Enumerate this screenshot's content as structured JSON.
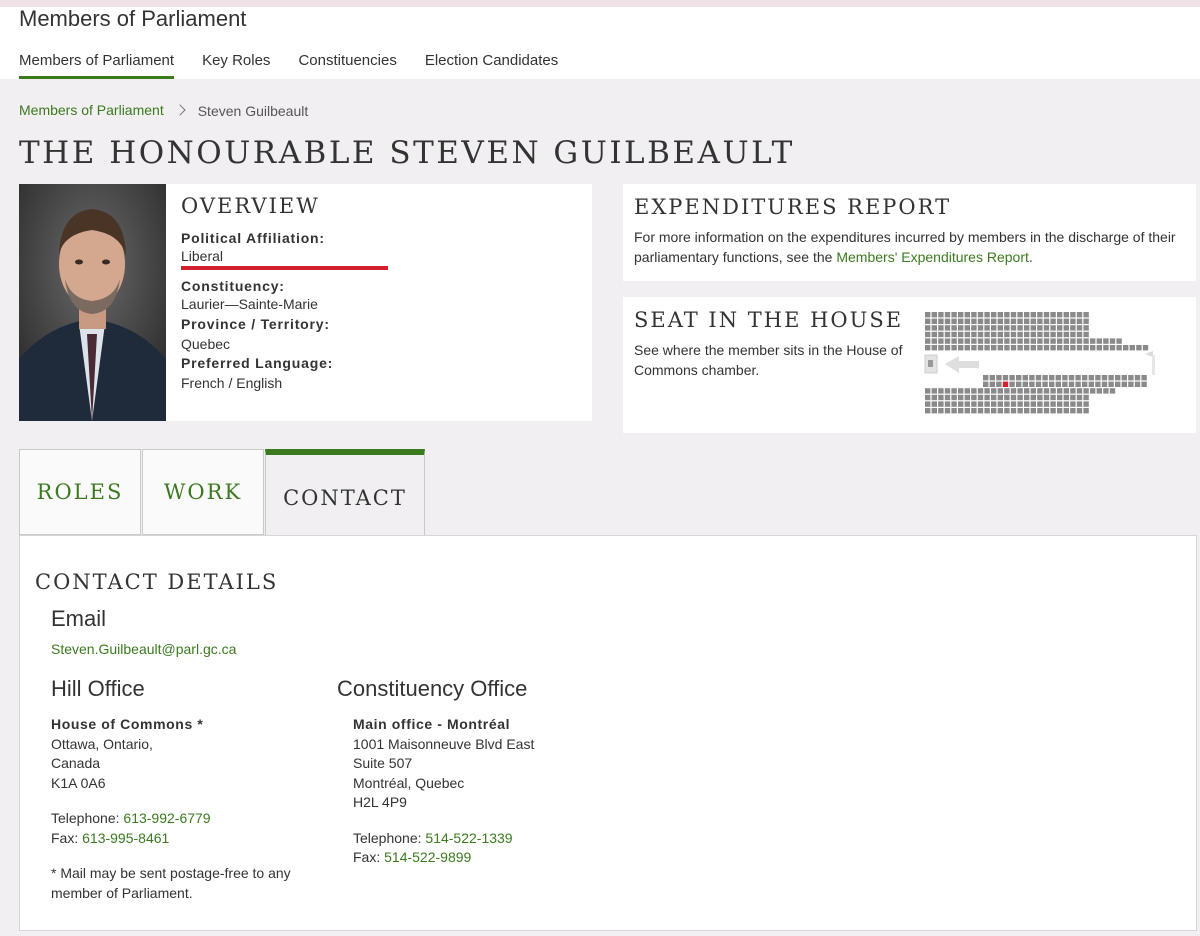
{
  "header": {
    "site_title": "Members of Parliament",
    "nav": [
      {
        "label": "Members of Parliament"
      },
      {
        "label": "Key Roles"
      },
      {
        "label": "Constituencies"
      },
      {
        "label": "Election Candidates"
      }
    ]
  },
  "breadcrumb": {
    "parent": "Members of Parliament",
    "current": "Steven Guilbeault"
  },
  "page_title": "THE HONOURABLE STEVEN GUILBEAULT",
  "overview": {
    "heading": "OVERVIEW",
    "affiliation_label": "Political Affiliation:",
    "affiliation": "Liberal",
    "party_color": "#d2202e",
    "constituency_label": "Constituency:",
    "constituency": "Laurier—Sainte-Marie",
    "province_label": "Province / Territory:",
    "province": "Quebec",
    "language_label": "Preferred Language:",
    "language": "French / English"
  },
  "expenditures": {
    "heading": "EXPENDITURES REPORT",
    "text": "For more information on the expenditures incurred by members in the discharge of their parliamentary functions, see the ",
    "link": "Members' Expenditures Report",
    "text_end": "."
  },
  "seat": {
    "heading": "SEAT IN THE HOUSE",
    "text": "See where the member sits in the House of Commons chamber."
  },
  "tabs": [
    {
      "label": "ROLES"
    },
    {
      "label": "WORK"
    },
    {
      "label": "CONTACT"
    }
  ],
  "contact": {
    "heading": "CONTACT DETAILS",
    "email_heading": "Email",
    "email": "Steven.Guilbeault@parl.gc.ca",
    "hill": {
      "heading": "Hill Office",
      "name": "House of Commons *",
      "line1": "Ottawa, Ontario,",
      "line2": "Canada",
      "line3": "K1A 0A6",
      "tel_label": "Telephone: ",
      "tel": "613-992-6779",
      "fax_label": "Fax: ",
      "fax": "613-995-8461",
      "note": "* Mail may be sent postage-free to any member of Parliament."
    },
    "constituency": {
      "heading": "Constituency Office",
      "name": "Main office - Montréal",
      "line1": "1001 Maisonneuve Blvd East",
      "line2": "Suite 507",
      "line3": "Montréal, Quebec",
      "line4": "H2L 4P9",
      "tel_label": "Telephone: ",
      "tel": "514-522-1339",
      "fax_label": "Fax: ",
      "fax": "514-522-9899"
    }
  },
  "colors": {
    "accent_green": "#3b7a1f",
    "seat_highlight": "#d2202e",
    "seat_gray": "#8a8a8a"
  }
}
